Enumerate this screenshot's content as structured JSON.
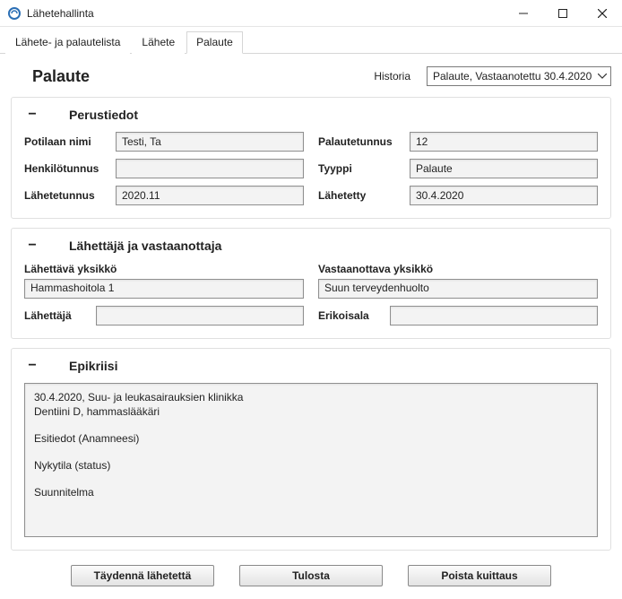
{
  "window": {
    "title": "Lähetehallinta"
  },
  "tabs": [
    {
      "label": "Lähete- ja palautelista"
    },
    {
      "label": "Lähete"
    },
    {
      "label": "Palaute"
    }
  ],
  "header": {
    "page_title": "Palaute",
    "history_label": "Historia",
    "history_selected": "Palaute, Vastaanotettu 30.4.2020"
  },
  "section_basic": {
    "title": "Perustiedot",
    "fields": {
      "patient_name_label": "Potilaan nimi",
      "patient_name_value": "Testi, Ta",
      "ssn_label": "Henkilötunnus",
      "ssn_value": "",
      "referral_id_label": "Lähetetunnus",
      "referral_id_value": "2020.11",
      "feedback_id_label": "Palautetunnus",
      "feedback_id_value": "12",
      "type_label": "Tyyppi",
      "type_value": "Palaute",
      "sent_label": "Lähetetty",
      "sent_value": "30.4.2020"
    }
  },
  "section_sender": {
    "title": "Lähettäjä ja vastaanottaja",
    "sending_unit_label": "Lähettävä yksikkö",
    "sending_unit_value": "Hammashoitola 1",
    "receiving_unit_label": "Vastaanottava yksikkö",
    "receiving_unit_value": "Suun terveydenhuolto",
    "sender_label": "Lähettäjä",
    "sender_value": "",
    "specialty_label": "Erikoisala",
    "specialty_value": ""
  },
  "section_epikriisi": {
    "title": "Epikriisi",
    "line1": "30.4.2020, Suu- ja leukasairauksien klinikka",
    "line2": "Dentiini D, hammaslääkäri",
    "line3": "Esitiedot (Anamneesi)",
    "line4": "Nykytila (status)",
    "line5": "Suunnitelma"
  },
  "buttons": {
    "supplement": "Täydennä lähetettä",
    "print": "Tulosta",
    "remove_ack": "Poista kuittaus"
  }
}
